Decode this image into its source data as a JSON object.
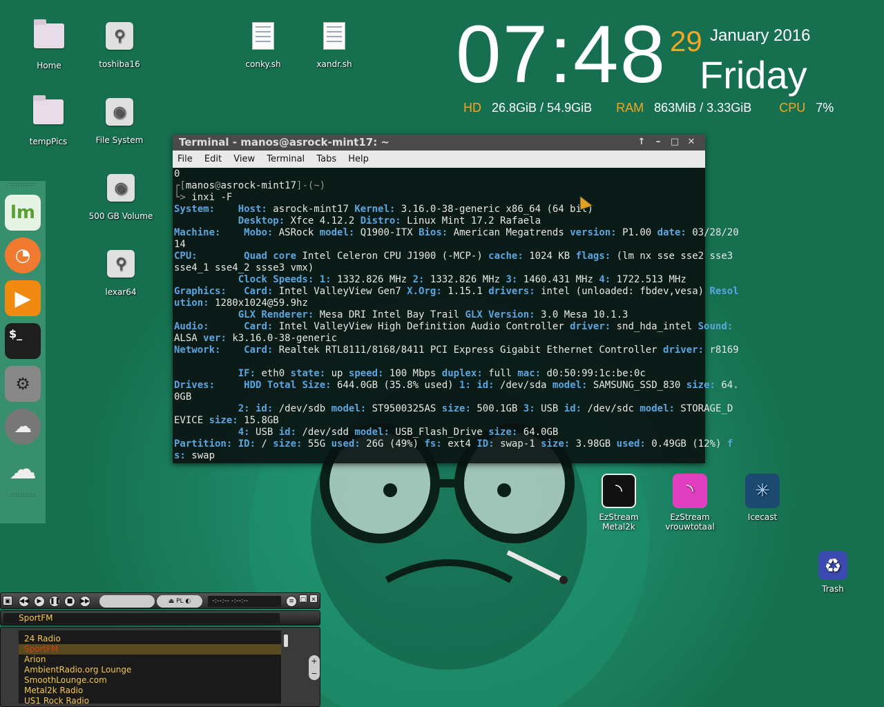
{
  "desktop_icons": [
    {
      "label": "Home",
      "icon": "home-folder-icon"
    },
    {
      "label": "toshiba16",
      "icon": "usb-drive-icon"
    },
    {
      "label": "conky.sh",
      "icon": "script-file-icon"
    },
    {
      "label": "xandr.sh",
      "icon": "script-file-icon"
    },
    {
      "label": "tempPics",
      "icon": "folder-icon"
    },
    {
      "label": "File System",
      "icon": "hard-drive-icon"
    },
    {
      "label": "500 GB Volume",
      "icon": "hard-drive-icon"
    },
    {
      "label": "lexar64",
      "icon": "usb-drive-icon"
    }
  ],
  "clock": {
    "time": "07:48",
    "day": "29",
    "month_year": "January 2016",
    "weekday": "Friday"
  },
  "stats": {
    "hd_label": "HD",
    "hd_value": "26.8GiB / 54.9GiB",
    "ram_label": "RAM",
    "ram_value": "863MiB  / 3.33GiB",
    "cpu_label": "CPU",
    "cpu_value": "7%"
  },
  "terminal": {
    "title": "Terminal - manos@asrock-mint17: ~",
    "menu": [
      "File",
      "Edit",
      "View",
      "Terminal",
      "Tabs",
      "Help"
    ],
    "lines": [
      [
        [
          "v",
          "0"
        ]
      ],
      [
        [
          "p",
          "┌["
        ],
        [
          "v",
          "manos"
        ],
        [
          "p",
          "@"
        ],
        [
          "v",
          "asrock-mint17"
        ],
        [
          "p",
          "]-(~)"
        ]
      ],
      [
        [
          "p",
          "└> "
        ],
        [
          "v",
          "inxi -F"
        ]
      ],
      [
        [
          "k",
          "System:    "
        ],
        [
          "k",
          "Host: "
        ],
        [
          "v",
          "asrock-mint17 "
        ],
        [
          "k",
          "Kernel: "
        ],
        [
          "v",
          "3.16.0-38-generic x86_64 (64 bit)"
        ]
      ],
      [
        [
          "v",
          "           "
        ],
        [
          "k",
          "Desktop: "
        ],
        [
          "v",
          "Xfce 4.12.2 "
        ],
        [
          "k",
          "Distro: "
        ],
        [
          "v",
          "Linux Mint 17.2 Rafaela"
        ]
      ],
      [
        [
          "k",
          "Machine:    "
        ],
        [
          "k",
          "Mobo: "
        ],
        [
          "v",
          "ASRock "
        ],
        [
          "k",
          "model: "
        ],
        [
          "v",
          "Q1900-ITX "
        ],
        [
          "k",
          "Bios: "
        ],
        [
          "v",
          "American Megatrends "
        ],
        [
          "k",
          "version: "
        ],
        [
          "v",
          "P1.00 "
        ],
        [
          "k",
          "date: "
        ],
        [
          "v",
          "03/28/20"
        ]
      ],
      [
        [
          "v",
          "14"
        ]
      ],
      [
        [
          "k",
          "CPU:        "
        ],
        [
          "k",
          "Quad core "
        ],
        [
          "v",
          "Intel Celeron CPU J1900 (-MCP-) "
        ],
        [
          "k",
          "cache: "
        ],
        [
          "v",
          "1024 KB "
        ],
        [
          "k",
          "flags: "
        ],
        [
          "v",
          "(lm nx sse sse2 sse3"
        ]
      ],
      [
        [
          "v",
          "sse4_1 sse4_2 ssse3 vmx)"
        ]
      ],
      [
        [
          "v",
          "           "
        ],
        [
          "k",
          "Clock Speeds: 1: "
        ],
        [
          "v",
          "1332.826 MHz "
        ],
        [
          "k",
          "2: "
        ],
        [
          "v",
          "1332.826 MHz "
        ],
        [
          "k",
          "3: "
        ],
        [
          "v",
          "1460.431 MHz "
        ],
        [
          "k",
          "4: "
        ],
        [
          "v",
          "1722.513 MHz"
        ]
      ],
      [
        [
          "k",
          "Graphics:   "
        ],
        [
          "k",
          "Card: "
        ],
        [
          "v",
          "Intel ValleyView Gen7 "
        ],
        [
          "k",
          "X.Org: "
        ],
        [
          "v",
          "1.15.1 "
        ],
        [
          "k",
          "drivers: "
        ],
        [
          "v",
          "intel (unloaded: fbdev,vesa) "
        ],
        [
          "k",
          "Resol"
        ]
      ],
      [
        [
          "k",
          "ution: "
        ],
        [
          "v",
          "1280x1024@59.9hz"
        ]
      ],
      [
        [
          "v",
          "           "
        ],
        [
          "k",
          "GLX Renderer: "
        ],
        [
          "v",
          "Mesa DRI Intel Bay Trail "
        ],
        [
          "k",
          "GLX Version: "
        ],
        [
          "v",
          "3.0 Mesa 10.1.3"
        ]
      ],
      [
        [
          "k",
          "Audio:      "
        ],
        [
          "k",
          "Card: "
        ],
        [
          "v",
          "Intel ValleyView High Definition Audio Controller "
        ],
        [
          "k",
          "driver: "
        ],
        [
          "v",
          "snd_hda_intel "
        ],
        [
          "k",
          "Sound:"
        ]
      ],
      [
        [
          "v",
          "ALSA "
        ],
        [
          "k",
          "ver: "
        ],
        [
          "v",
          "k3.16.0-38-generic"
        ]
      ],
      [
        [
          "k",
          "Network:    "
        ],
        [
          "k",
          "Card: "
        ],
        [
          "v",
          "Realtek RTL8111/8168/8411 PCI Express Gigabit Ethernet Controller "
        ],
        [
          "k",
          "driver: "
        ],
        [
          "v",
          "r8169"
        ]
      ],
      [
        [
          "v",
          ""
        ]
      ],
      [
        [
          "v",
          "           "
        ],
        [
          "k",
          "IF: "
        ],
        [
          "v",
          "eth0 "
        ],
        [
          "k",
          "state: "
        ],
        [
          "v",
          "up "
        ],
        [
          "k",
          "speed: "
        ],
        [
          "v",
          "100 Mbps "
        ],
        [
          "k",
          "duplex: "
        ],
        [
          "v",
          "full "
        ],
        [
          "k",
          "mac: "
        ],
        [
          "v",
          "d0:50:99:1c:be:0c"
        ]
      ],
      [
        [
          "k",
          "Drives:     "
        ],
        [
          "k",
          "HDD Total Size: "
        ],
        [
          "v",
          "644.0GB (35.8% used) "
        ],
        [
          "k",
          "1: id: "
        ],
        [
          "v",
          "/dev/sda "
        ],
        [
          "k",
          "model: "
        ],
        [
          "v",
          "SAMSUNG_SSD_830 "
        ],
        [
          "k",
          "size: "
        ],
        [
          "v",
          "64."
        ]
      ],
      [
        [
          "v",
          "0GB"
        ]
      ],
      [
        [
          "v",
          "           "
        ],
        [
          "k",
          "2: id: "
        ],
        [
          "v",
          "/dev/sdb "
        ],
        [
          "k",
          "model: "
        ],
        [
          "v",
          "ST9500325AS "
        ],
        [
          "k",
          "size: "
        ],
        [
          "v",
          "500.1GB "
        ],
        [
          "k",
          "3: "
        ],
        [
          "v",
          "USB "
        ],
        [
          "k",
          "id: "
        ],
        [
          "v",
          "/dev/sdc "
        ],
        [
          "k",
          "model: "
        ],
        [
          "v",
          "STORAGE_D"
        ]
      ],
      [
        [
          "v",
          "EVICE "
        ],
        [
          "k",
          "size: "
        ],
        [
          "v",
          "15.8GB"
        ]
      ],
      [
        [
          "v",
          "           "
        ],
        [
          "k",
          "4: "
        ],
        [
          "v",
          "USB "
        ],
        [
          "k",
          "id: "
        ],
        [
          "v",
          "/dev/sdd "
        ],
        [
          "k",
          "model: "
        ],
        [
          "v",
          "USB_Flash_Drive "
        ],
        [
          "k",
          "size: "
        ],
        [
          "v",
          "64.0GB"
        ]
      ],
      [
        [
          "k",
          "Partition: "
        ],
        [
          "k",
          "ID: "
        ],
        [
          "v",
          "/ "
        ],
        [
          "k",
          "size: "
        ],
        [
          "v",
          "55G "
        ],
        [
          "k",
          "used: "
        ],
        [
          "v",
          "26G (49%) "
        ],
        [
          "k",
          "fs: "
        ],
        [
          "v",
          "ext4 "
        ],
        [
          "k",
          "ID: "
        ],
        [
          "v",
          "swap-1 "
        ],
        [
          "k",
          "size: "
        ],
        [
          "v",
          "3.98GB "
        ],
        [
          "k",
          "used: "
        ],
        [
          "v",
          "0.49GB (12%) "
        ],
        [
          "k",
          "f"
        ]
      ],
      [
        [
          "k",
          "s: "
        ],
        [
          "v",
          "swap"
        ]
      ]
    ]
  },
  "shortcuts": [
    {
      "label": "EzStream\nMetal2k",
      "icon": "rss-feed-icon",
      "color": "#111111"
    },
    {
      "label": "EzStream\nvrouwtotaal",
      "icon": "rss-feed-icon",
      "color": "#e040c0"
    },
    {
      "label": "Icecast",
      "icon": "icecast-icon",
      "color": "#2a6a9a"
    },
    {
      "label": "Trash",
      "icon": "trash-recycle-icon",
      "color": "#3a4ab0"
    }
  ],
  "player": {
    "time_display": "-:--:--      -:--:--",
    "current_station": "SportFM",
    "playlist": [
      "24 Radio",
      "SportFM",
      "Arion",
      "AmbientRadio.org Lounge",
      "SmoothLounge.com",
      "Metal2k Radio",
      "US1 Rock Radio"
    ],
    "selected_index": 1
  }
}
